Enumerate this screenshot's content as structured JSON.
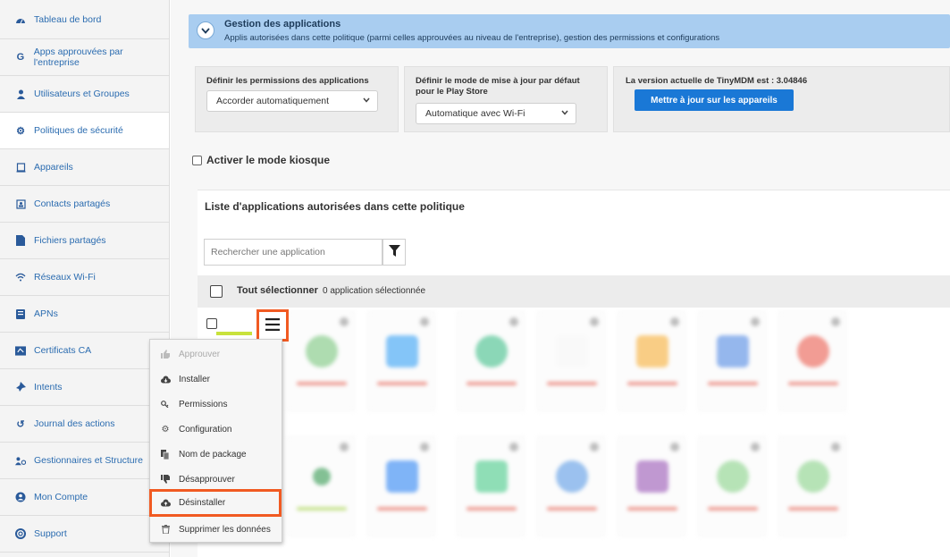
{
  "sidebar": {
    "items": [
      {
        "label": "Tableau de bord",
        "icon": "dashboard-icon"
      },
      {
        "label": "Apps approuvées par l'entreprise",
        "icon": "google-icon"
      },
      {
        "label": "Utilisateurs et Groupes",
        "icon": "user-icon"
      },
      {
        "label": "Politiques de sécurité",
        "icon": "gears-icon"
      },
      {
        "label": "Appareils",
        "icon": "device-icon"
      },
      {
        "label": "Contacts partagés",
        "icon": "contact-card-icon"
      },
      {
        "label": "Fichiers partagés",
        "icon": "file-icon"
      },
      {
        "label": "Réseaux Wi-Fi",
        "icon": "wifi-icon"
      },
      {
        "label": "APNs",
        "icon": "apn-icon"
      },
      {
        "label": "Certificats CA",
        "icon": "certificate-icon"
      },
      {
        "label": "Intents",
        "icon": "thumbtack-icon"
      },
      {
        "label": "Journal des actions",
        "icon": "history-icon"
      },
      {
        "label": "Gestionnaires et Structure",
        "icon": "users-gear-icon"
      },
      {
        "label": "Mon Compte",
        "icon": "account-icon"
      },
      {
        "label": "Support",
        "icon": "lifebuoy-icon"
      }
    ]
  },
  "gestion": {
    "title": "Gestion des applications",
    "subtitle": "Applis autorisées dans cette politique (parmi celles approuvées au niveau de l'entreprise), gestion des permissions et configurations"
  },
  "permissions": {
    "label": "Définir les permissions des applications",
    "value": "Accorder automatiquement"
  },
  "update_mode": {
    "label_line1": "Définir le mode de mise à jour par défaut",
    "label_line2": "pour le Play Store",
    "value": "Automatique avec Wi-Fi"
  },
  "version": {
    "label": "La version actuelle de TinyMDM est : 3.04846",
    "button": "Mettre à jour sur les appareils"
  },
  "kiosk": {
    "label": "Activer le mode kiosque"
  },
  "app_list": {
    "title": "Liste d'applications autorisées dans cette politique",
    "search_placeholder": "Rechercher une application",
    "select_all": "Tout sélectionner",
    "selected_count": "0 application sélectionnée"
  },
  "context_menu": {
    "items": [
      {
        "label": "Approuver",
        "icon": "thumbs-up-icon",
        "disabled": true
      },
      {
        "label": "Installer",
        "icon": "cloud-download-icon",
        "disabled": false
      },
      {
        "label": "Permissions",
        "icon": "key-icon",
        "disabled": false
      },
      {
        "label": "Configuration",
        "icon": "cogs-icon",
        "disabled": false
      },
      {
        "label": "Nom de package",
        "icon": "copy-icon",
        "disabled": false
      },
      {
        "label": "Désapprouver",
        "icon": "thumbs-down-icon",
        "disabled": false
      },
      {
        "label": "Désinstaller",
        "icon": "cloud-upload-icon",
        "disabled": false
      },
      {
        "label": "Supprimer les données",
        "icon": "trash-icon",
        "disabled": false
      }
    ]
  },
  "colors": {
    "accent": "#1a78d6",
    "highlight": "#f15a22",
    "gestion_bar": "#a9cdf0",
    "sidebar_link": "#2b6cb0"
  }
}
